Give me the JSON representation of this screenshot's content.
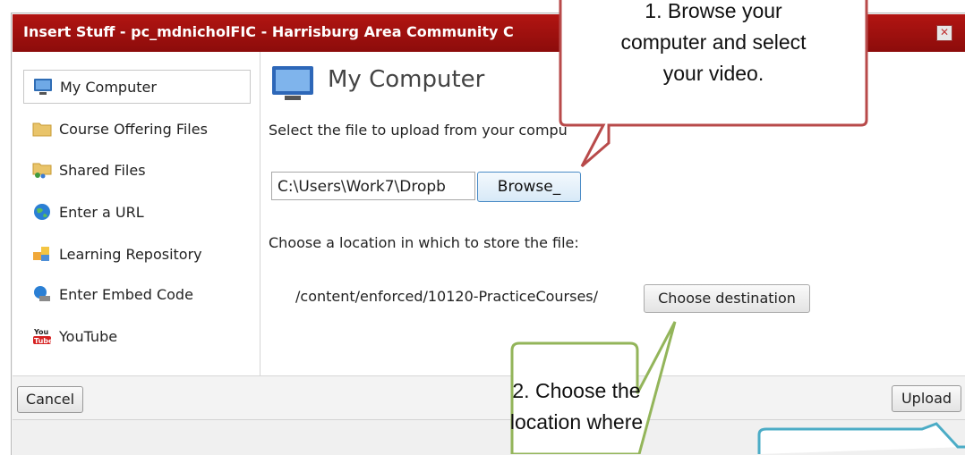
{
  "window": {
    "title": "Insert Stuff - pc_mdnicholFIC - Harrisburg Area Community C",
    "close_icon": "close-icon"
  },
  "sidebar": {
    "items": [
      {
        "label": "My Computer",
        "icon": "monitor-icon",
        "selected": true
      },
      {
        "label": "Course Offering Files",
        "icon": "folder-icon"
      },
      {
        "label": "Shared Files",
        "icon": "shared-folder-icon"
      },
      {
        "label": "Enter a URL",
        "icon": "globe-icon"
      },
      {
        "label": "Learning Repository",
        "icon": "puzzle-icon"
      },
      {
        "label": "Enter Embed Code",
        "icon": "embed-globe-icon"
      },
      {
        "label": "YouTube",
        "icon": "youtube-icon"
      }
    ]
  },
  "main": {
    "heading": "My Computer",
    "instruction_select": "Select the file to upload from your compu",
    "file_value": "C:\\Users\\Work7\\Dropb",
    "browse_label": "Browse_",
    "instruction_location": "Choose a location in which to store the file:",
    "destination_path": "/content/enforced/10120-PracticeCourses/",
    "choose_label": "Choose destination"
  },
  "footer": {
    "cancel_label": "Cancel",
    "upload_label": "Upload"
  },
  "callouts": {
    "one_lines": [
      "1. Browse your",
      "computer and select",
      "your video."
    ],
    "two_lines": [
      "2. Choose the",
      "location where"
    ]
  },
  "colors": {
    "titlebar": "#a01210",
    "callout_one": "#c0504d",
    "callout_two": "#9bbb59",
    "callout_three": "#4bacc6"
  }
}
